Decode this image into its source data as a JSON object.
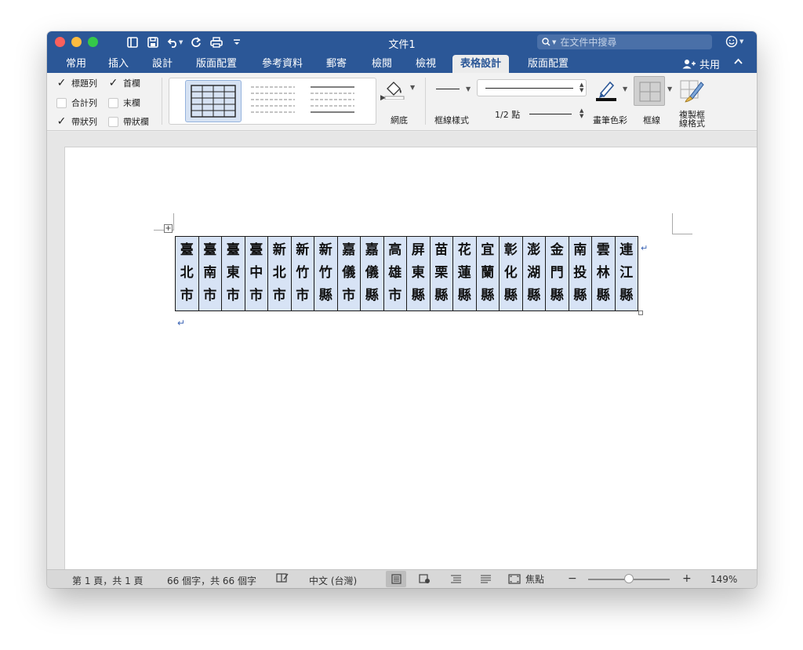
{
  "title_bar": {
    "doc_title": "文件1",
    "search_placeholder": "在文件中搜尋",
    "search_icon": "search-icon",
    "user_icon": "smiley-icon",
    "quick_access": [
      "sidebar-icon",
      "save-icon",
      "undo-icon",
      "redo-icon",
      "print-icon",
      "customize-icon"
    ]
  },
  "tabs": [
    {
      "label": "常用",
      "active": false
    },
    {
      "label": "插入",
      "active": false
    },
    {
      "label": "設計",
      "active": false
    },
    {
      "label": "版面配置",
      "active": false
    },
    {
      "label": "參考資料",
      "active": false
    },
    {
      "label": "郵寄",
      "active": false
    },
    {
      "label": "檢閱",
      "active": false
    },
    {
      "label": "檢視",
      "active": false
    },
    {
      "label": "表格設計",
      "active": true
    },
    {
      "label": "版面配置",
      "active": false
    }
  ],
  "share_label": "共用",
  "ribbon": {
    "options": [
      {
        "label": "標題列",
        "checked": true
      },
      {
        "label": "首欄",
        "checked": true
      },
      {
        "label": "合計列",
        "checked": false
      },
      {
        "label": "末欄",
        "checked": false
      },
      {
        "label": "帶狀列",
        "checked": true
      },
      {
        "label": "帶狀欄",
        "checked": false
      }
    ],
    "shading_label": "網底",
    "border_styles_label": "框線樣式",
    "line_weight": "1/2 點",
    "pen_color_label": "畫筆色彩",
    "borders_label": "框線",
    "border_painter_label": "複製框\n線格式"
  },
  "table_cells": [
    [
      "臺",
      "北",
      "市"
    ],
    [
      "臺",
      "南",
      "市"
    ],
    [
      "臺",
      "東",
      "市"
    ],
    [
      "臺",
      "中",
      "市"
    ],
    [
      "新",
      "北",
      "市"
    ],
    [
      "新",
      "竹",
      "市"
    ],
    [
      "新",
      "竹",
      "縣"
    ],
    [
      "嘉",
      "儀",
      "市"
    ],
    [
      "嘉",
      "儀",
      "縣"
    ],
    [
      "高",
      "雄",
      "市"
    ],
    [
      "屏",
      "東",
      "縣"
    ],
    [
      "苗",
      "栗",
      "縣"
    ],
    [
      "花",
      "蓮",
      "縣"
    ],
    [
      "宜",
      "蘭",
      "縣"
    ],
    [
      "彰",
      "化",
      "縣"
    ],
    [
      "澎",
      "湖",
      "縣"
    ],
    [
      "金",
      "門",
      "縣"
    ],
    [
      "南",
      "投",
      "縣"
    ],
    [
      "雲",
      "林",
      "縣"
    ],
    [
      "連",
      "江",
      "縣"
    ]
  ],
  "status_bar": {
    "page_info": "第 1 頁，共 1 頁",
    "word_count": "66 個字，共 66 個字",
    "language": "中文 (台灣)",
    "focus_label": "焦點",
    "zoom_minus": "−",
    "zoom_plus": "+",
    "zoom_level": "149%",
    "zoom_fraction": 0.5
  },
  "colors": {
    "accent": "#2b5797",
    "table_fill": "#d7e3f5",
    "para_mark": "#3a63b4"
  }
}
